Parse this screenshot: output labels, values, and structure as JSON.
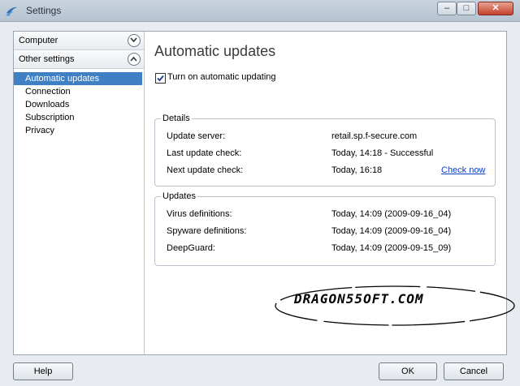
{
  "window": {
    "title": "Settings"
  },
  "sidebar": {
    "categories": [
      {
        "label": "Computer"
      },
      {
        "label": "Other settings"
      }
    ],
    "items": [
      {
        "label": "Automatic updates"
      },
      {
        "label": "Connection"
      },
      {
        "label": "Downloads"
      },
      {
        "label": "Subscription"
      },
      {
        "label": "Privacy"
      }
    ]
  },
  "main": {
    "heading": "Automatic updates",
    "checkbox_label": "Turn on automatic updating",
    "checkbox_checked": true,
    "details": {
      "legend": "Details",
      "rows": [
        {
          "label": "Update server:",
          "value": "retail.sp.f-secure.com"
        },
        {
          "label": "Last update check:",
          "value": "Today, 14:18 - Successful"
        },
        {
          "label": "Next update check:",
          "value": "Today, 16:18"
        }
      ],
      "check_now": "Check now"
    },
    "updates": {
      "legend": "Updates",
      "rows": [
        {
          "label": "Virus definitions:",
          "value": "Today, 14:09 (2009-09-16_04)"
        },
        {
          "label": "Spyware definitions:",
          "value": "Today, 14:09 (2009-09-16_04)"
        },
        {
          "label": "DeepGuard:",
          "value": "Today, 14:09 (2009-09-15_09)"
        }
      ]
    },
    "watermark_text": "DRAGON55OFT.COM"
  },
  "buttons": {
    "help": "Help",
    "ok": "OK",
    "cancel": "Cancel"
  },
  "colors": {
    "selection": "#3f7fc4",
    "link": "#0b3ec9"
  }
}
